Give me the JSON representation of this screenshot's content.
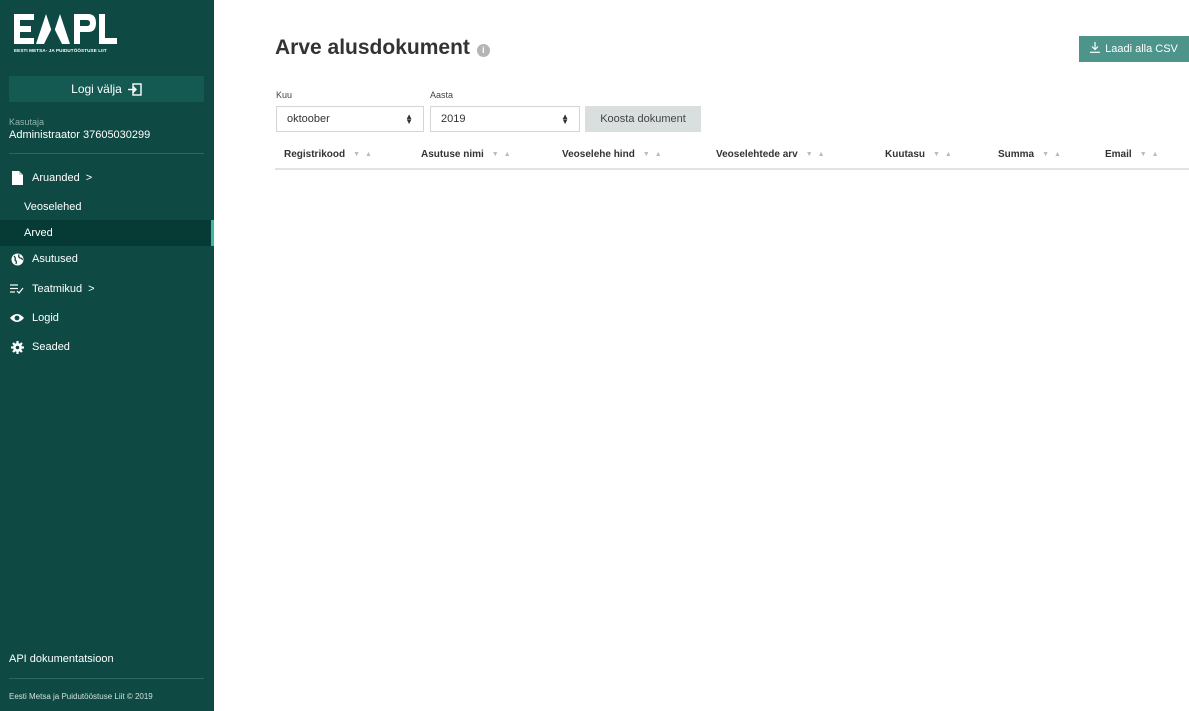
{
  "sidebar": {
    "logo_text": "EMPL",
    "logo_subtitle": "EESTI METSA- JA PUIDUTÖÖSTUSE LIIT",
    "logout_label": "Logi välja",
    "user_label": "Kasutaja",
    "user_name": "Administraator 37605030299",
    "items": [
      {
        "label": "Aruanded",
        "icon": "document-icon",
        "chevron": ">"
      },
      {
        "label": "Veoselehed"
      },
      {
        "label": "Arved",
        "active": true
      },
      {
        "label": "Asutused",
        "icon": "globe-icon"
      },
      {
        "label": "Teatmikud",
        "icon": "list-check-icon",
        "chevron": ">"
      },
      {
        "label": "Logid",
        "icon": "eye-icon"
      },
      {
        "label": "Seaded",
        "icon": "gear-icon"
      }
    ],
    "api_link": "API dokumentatsioon",
    "footer": "Eesti Metsa ja Puidutööstuse Liit © 2019"
  },
  "main": {
    "title": "Arve alusdokument",
    "csv_button": "Laadi alla CSV",
    "month_label": "Kuu",
    "month_value": "oktoober",
    "year_label": "Aasta",
    "year_value": "2019",
    "generate_button": "Koosta dokument",
    "columns": [
      "Registrikood",
      "Asutuse nimi",
      "Veoselehe hind",
      "Veoselehtede arv",
      "Kuutasu",
      "Summa",
      "Email"
    ]
  },
  "colors": {
    "sidebar_bg": "#0e4a43",
    "accent": "#4d948b",
    "active_indicator": "#3fb8a3"
  }
}
